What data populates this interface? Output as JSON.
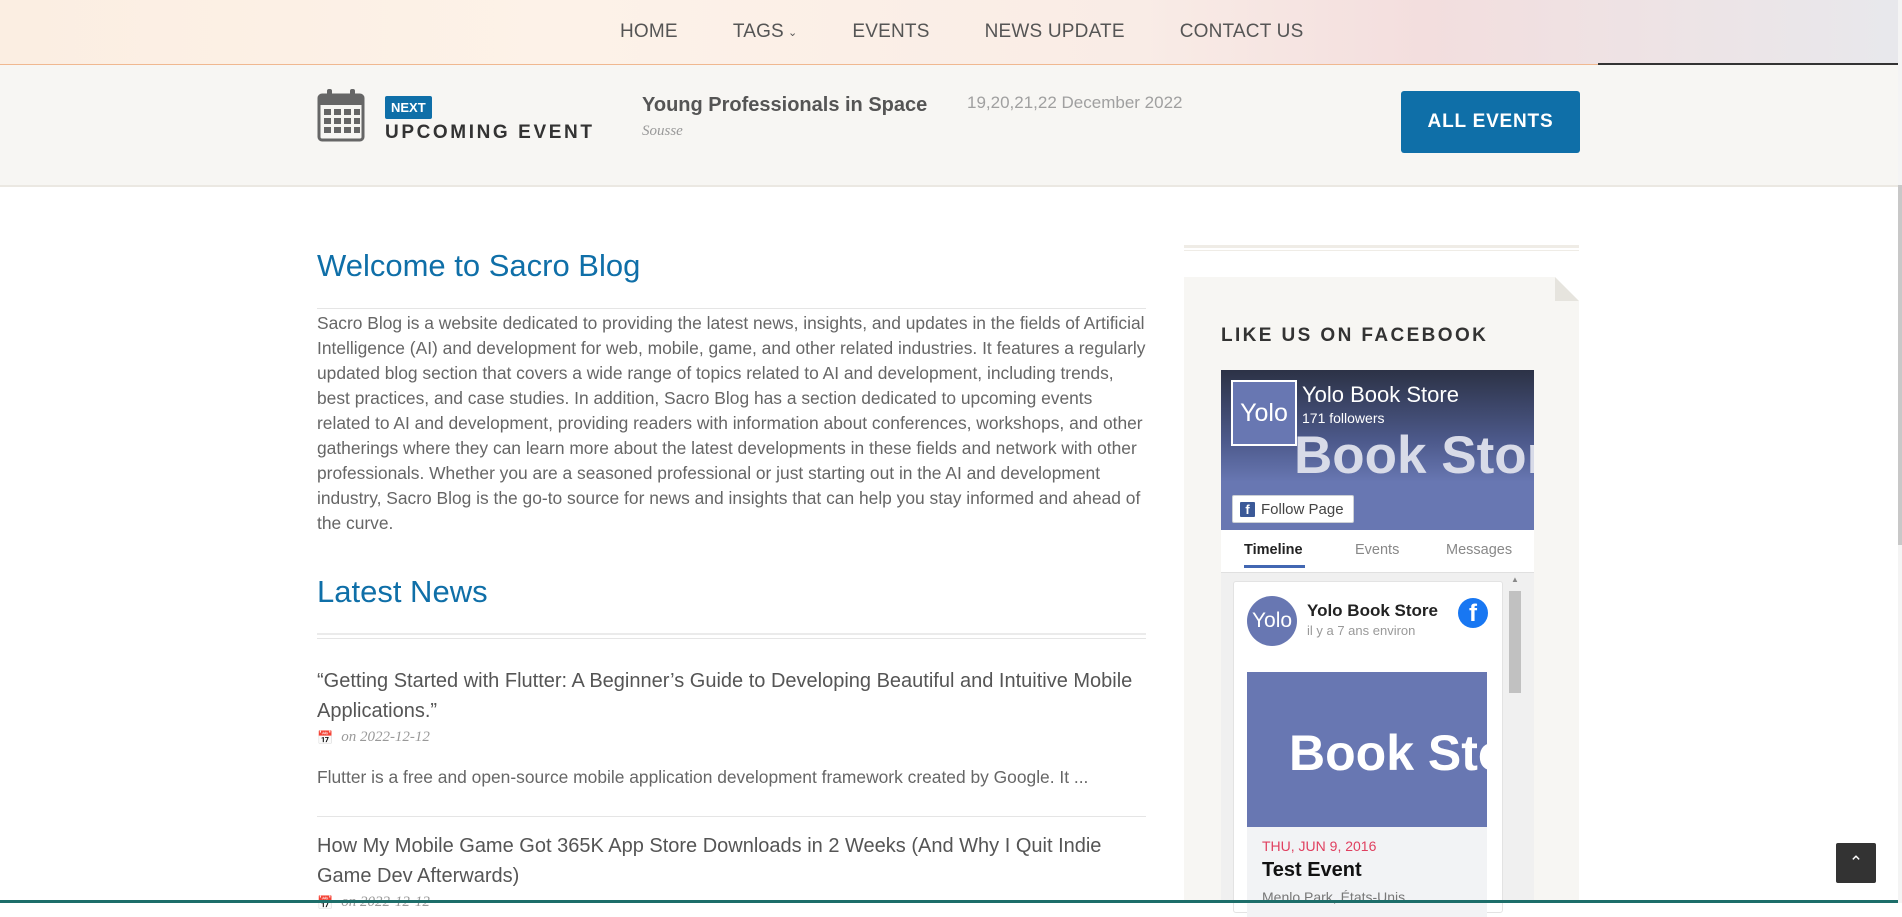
{
  "nav": {
    "items": [
      "HOME",
      "TAGS",
      "EVENTS",
      "NEWS UPDATE",
      "CONTACT US"
    ],
    "tags_chevron": "⌄"
  },
  "upcoming": {
    "badge": "NEXT",
    "label": "UPCOMING EVENT",
    "event_title": "Young Professionals in Space",
    "event_location": "Sousse",
    "event_date": "19,20,21,22 December 2022",
    "button": "ALL EVENTS"
  },
  "main": {
    "welcome_title": "Welcome to Sacro Blog",
    "intro": "Sacro Blog is a website dedicated to providing the latest news, insights, and updates in the fields of Artificial Intelligence (AI) and development for web, mobile, game, and other related industries. It features a regularly updated blog section that covers a wide range of topics related to AI and development, including trends, best practices, and case studies. In addition, Sacro Blog has a section dedicated to upcoming events related to AI and development, providing readers with information about conferences, workshops, and other gatherings where they can learn more about the latest developments in these fields and network with other professionals. Whether you are a seasoned professional or just starting out in the AI and development industry, Sacro Blog is the go-to source for news and insights that can help you stay informed and ahead of the curve.",
    "news_title": "Latest News",
    "news": [
      {
        "title": "“Getting Started with Flutter: A Beginner’s Guide to Developing Beautiful and Intuitive Mobile Applications.”",
        "date": "on 2022-12-12",
        "excerpt": "Flutter is a free and open-source mobile application development framework created by Google. It ..."
      },
      {
        "title": "How My Mobile Game Got 365K App Store Downloads in 2 Weeks (And Why I Quit Indie Game Dev Afterwards)",
        "date": "on 2022-12-12"
      }
    ]
  },
  "sidebar": {
    "heading": "LIKE US ON FACEBOOK",
    "fb": {
      "page_name": "Yolo Book Store",
      "followers": "171 followers",
      "avatar_text": "Yolo",
      "cover_text": "Book Stor",
      "follow_button": "Follow Page",
      "tabs": [
        "Timeline",
        "Events",
        "Messages"
      ],
      "post": {
        "name": "Yolo Book Store",
        "time": "il y a 7 ans environ",
        "image_text": "Book Sto",
        "event_date": "THU, JUN 9, 2016",
        "event_title": "Test Event",
        "event_location": "Menlo Park, États-Unis"
      }
    }
  },
  "colors": {
    "accent": "#0f6fa8",
    "facebook_blue": "#1877f2",
    "event_date_red": "#e04060"
  },
  "icons": {
    "calendar": "calendar-icon",
    "back_to_top": "double-chevron-up-icon"
  }
}
